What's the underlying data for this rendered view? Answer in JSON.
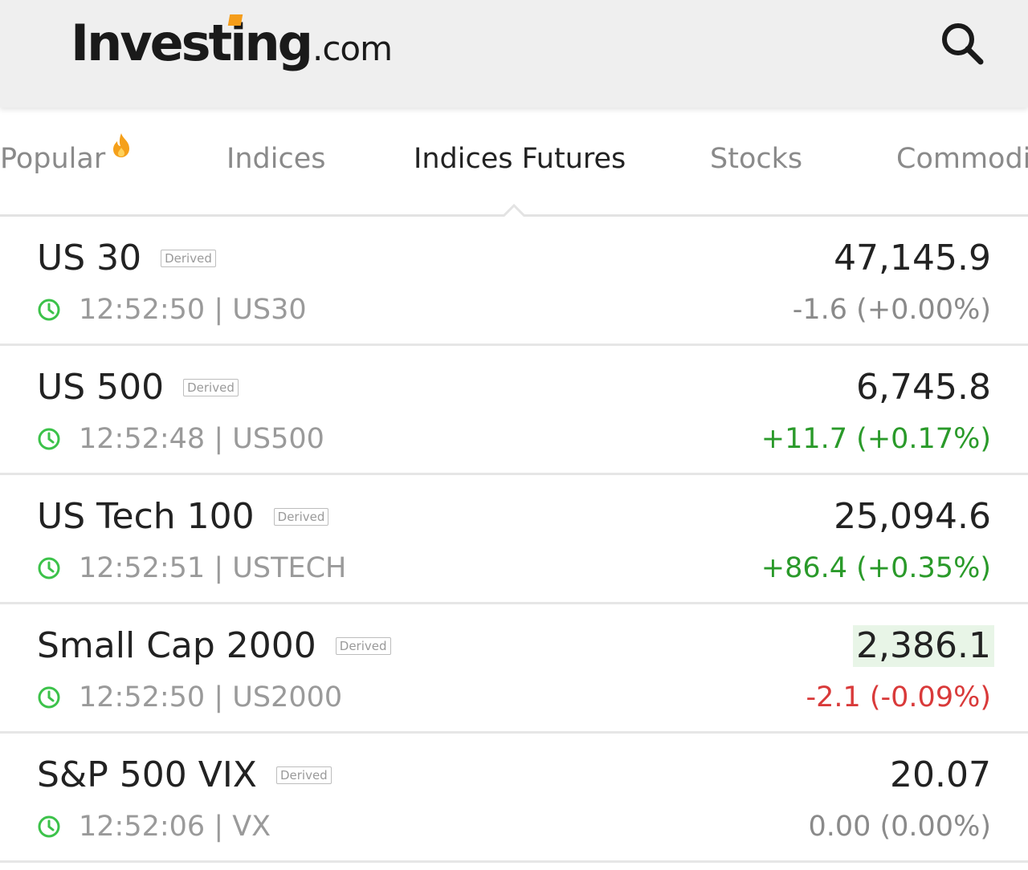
{
  "header": {
    "logo_main": "Investing",
    "logo_suffix": ".com",
    "search_icon": "search-icon"
  },
  "tabs": [
    {
      "label": "Popular",
      "active": false,
      "icon": "fire-icon"
    },
    {
      "label": "Indices",
      "active": false
    },
    {
      "label": "Indices Futures",
      "active": true
    },
    {
      "label": "Stocks",
      "active": false
    },
    {
      "label": "Commodit",
      "active": false
    }
  ],
  "instruments": [
    {
      "name": "US 30",
      "badge": "Derived",
      "time": "12:52:50",
      "symbol": "US30",
      "meta": "12:52:50 | US30",
      "price": "47,145.9",
      "change": "-1.6 (+0.00%)",
      "direction": "neutral",
      "highlight": false
    },
    {
      "name": "US 500",
      "badge": "Derived",
      "time": "12:52:48",
      "symbol": "US500",
      "meta": "12:52:48 | US500",
      "price": "6,745.8",
      "change": "+11.7 (+0.17%)",
      "direction": "up",
      "highlight": false
    },
    {
      "name": "US Tech 100",
      "badge": "Derived",
      "time": "12:52:51",
      "symbol": "USTECH",
      "meta": "12:52:51 | USTECH",
      "price": "25,094.6",
      "change": "+86.4 (+0.35%)",
      "direction": "up",
      "highlight": false
    },
    {
      "name": "Small Cap 2000",
      "badge": "Derived",
      "time": "12:52:50",
      "symbol": "US2000",
      "meta": "12:52:50 | US2000",
      "price": "2,386.1",
      "change": "-2.1 (-0.09%)",
      "direction": "down",
      "highlight": true
    },
    {
      "name": "S&P 500 VIX",
      "badge": "Derived",
      "time": "12:52:06",
      "symbol": "VX",
      "meta": "12:52:06 | VX",
      "price": "20.07",
      "change": "0.00 (0.00%)",
      "direction": "neutral",
      "highlight": false
    }
  ],
  "colors": {
    "up": "#2a9a2a",
    "down": "#d93a3a",
    "neutral": "#8a8a8a",
    "clock": "#3cc24a",
    "logo_accent": "#f59d1a",
    "fire": "#f5a01a"
  }
}
